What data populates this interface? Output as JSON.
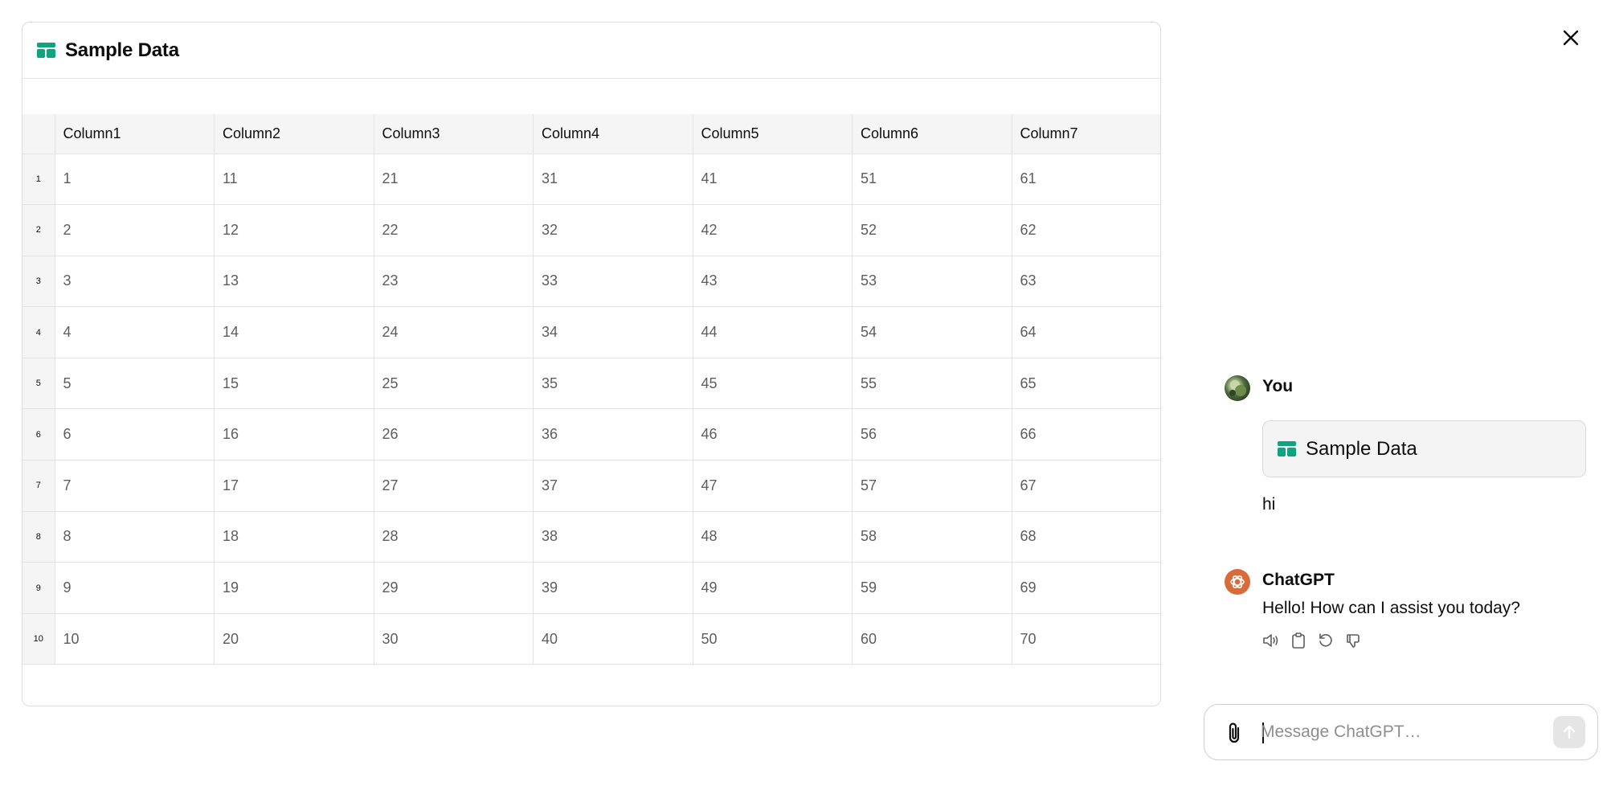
{
  "sheet": {
    "title": "Sample Data",
    "columns": [
      "Column1",
      "Column2",
      "Column3",
      "Column4",
      "Column5",
      "Column6",
      "Column7"
    ],
    "rows": [
      {
        "index": "1",
        "cells": [
          "1",
          "11",
          "21",
          "31",
          "41",
          "51",
          "61"
        ]
      },
      {
        "index": "2",
        "cells": [
          "2",
          "12",
          "22",
          "32",
          "42",
          "52",
          "62"
        ]
      },
      {
        "index": "3",
        "cells": [
          "3",
          "13",
          "23",
          "33",
          "43",
          "53",
          "63"
        ]
      },
      {
        "index": "4",
        "cells": [
          "4",
          "14",
          "24",
          "34",
          "44",
          "54",
          "64"
        ]
      },
      {
        "index": "5",
        "cells": [
          "5",
          "15",
          "25",
          "35",
          "45",
          "55",
          "65"
        ]
      },
      {
        "index": "6",
        "cells": [
          "6",
          "16",
          "26",
          "36",
          "46",
          "56",
          "66"
        ]
      },
      {
        "index": "7",
        "cells": [
          "7",
          "17",
          "27",
          "37",
          "47",
          "57",
          "67"
        ]
      },
      {
        "index": "8",
        "cells": [
          "8",
          "18",
          "28",
          "38",
          "48",
          "58",
          "68"
        ]
      },
      {
        "index": "9",
        "cells": [
          "9",
          "19",
          "29",
          "39",
          "49",
          "59",
          "69"
        ]
      },
      {
        "index": "10",
        "cells": [
          "10",
          "20",
          "30",
          "40",
          "50",
          "60",
          "70"
        ]
      }
    ]
  },
  "chat": {
    "user": {
      "author": "You",
      "attachment_title": "Sample Data",
      "text": "hi"
    },
    "assistant": {
      "author": "ChatGPT",
      "text": "Hello! How can I assist you today?"
    },
    "actions": [
      "speaker-icon",
      "copy-icon",
      "regenerate-icon",
      "thumbs-down-icon"
    ]
  },
  "composer": {
    "placeholder": "Message ChatGPT…"
  },
  "colors": {
    "sheet_icon": "#10a37f",
    "assistant_avatar": "#d96b3a",
    "header_bg": "#f5f5f5",
    "grid_line": "#e3e3e3"
  }
}
